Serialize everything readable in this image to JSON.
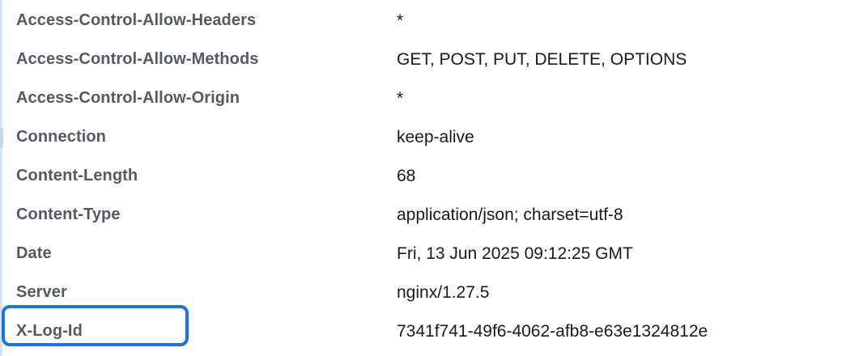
{
  "response_headers": [
    {
      "name": "Access-Control-Allow-Headers",
      "value": "*"
    },
    {
      "name": "Access-Control-Allow-Methods",
      "value": "GET, POST, PUT, DELETE, OPTIONS"
    },
    {
      "name": "Access-Control-Allow-Origin",
      "value": "*"
    },
    {
      "name": "Connection",
      "value": "keep-alive"
    },
    {
      "name": "Content-Length",
      "value": "68"
    },
    {
      "name": "Content-Type",
      "value": "application/json; charset=utf-8"
    },
    {
      "name": "Date",
      "value": "Fri, 13 Jun 2025 09:12:25 GMT"
    },
    {
      "name": "Server",
      "value": "nginx/1.27.5"
    },
    {
      "name": "X-Log-Id",
      "value": "7341f741-49f6-4062-afb8-e63e1324812e"
    }
  ],
  "highlight": {
    "target": "X-Log-Id",
    "color": "#1a73e8"
  },
  "colors": {
    "name_text": "#555a60",
    "value_text": "#1a1a1a",
    "accent": "#1a73e8"
  }
}
